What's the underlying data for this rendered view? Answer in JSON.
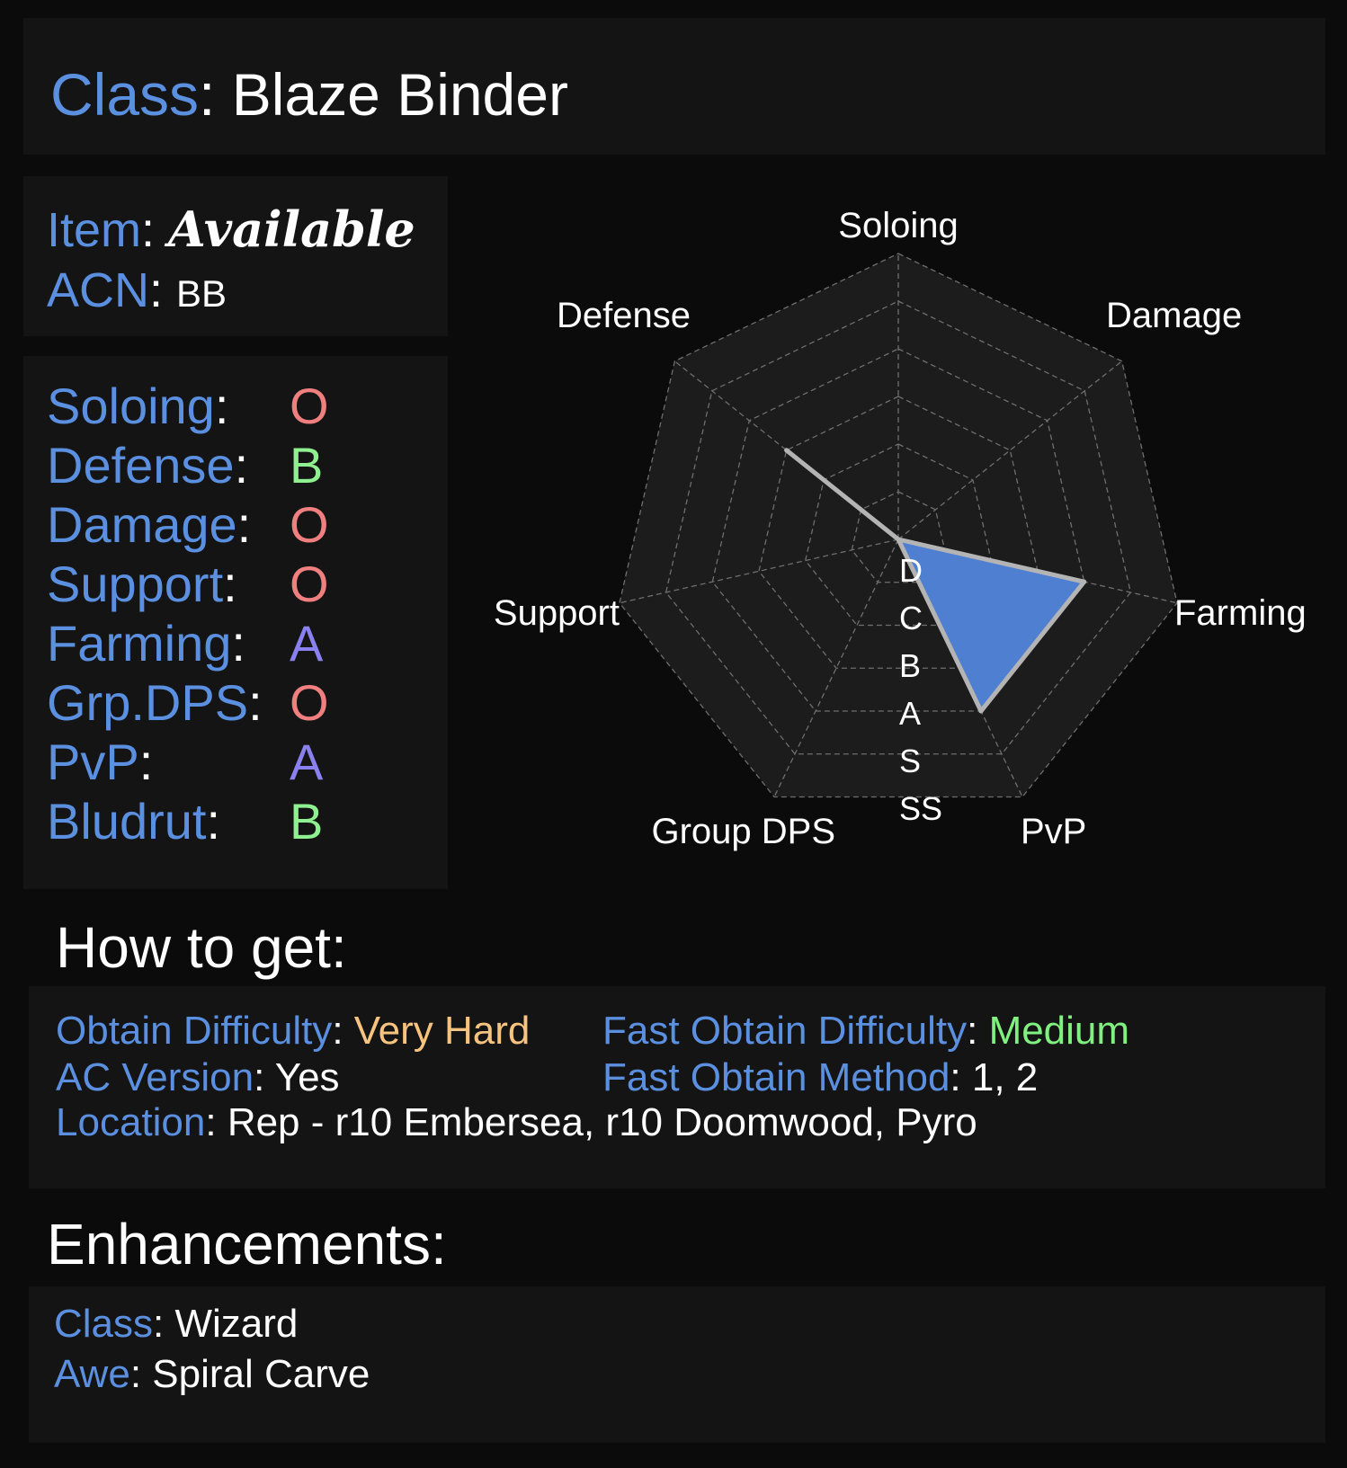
{
  "header": {
    "class_label": "Class",
    "class_value": "Blaze Binder"
  },
  "info": {
    "item_label": "Item",
    "item_value": "Available",
    "acn_label": "ACN",
    "acn_value": "BB"
  },
  "grades": [
    {
      "label": "Soloing",
      "value": "O",
      "color": "#f08080"
    },
    {
      "label": "Defense",
      "value": "B",
      "color": "#8ef08e"
    },
    {
      "label": "Damage",
      "value": "O",
      "color": "#f08080"
    },
    {
      "label": "Support",
      "value": "O",
      "color": "#f08080"
    },
    {
      "label": "Farming",
      "value": "A",
      "color": "#8a80f0"
    },
    {
      "label": "Grp.DPS",
      "value": "O",
      "color": "#f08080"
    },
    {
      "label": "PvP",
      "value": "A",
      "color": "#8a80f0"
    },
    {
      "label": "Bludrut",
      "value": "B",
      "color": "#8ef08e"
    }
  ],
  "chart_data": {
    "type": "radar",
    "axes": [
      "Soloing",
      "Damage",
      "Farming",
      "PvP",
      "Group DPS",
      "Support",
      "Defense"
    ],
    "scale_labels": [
      "D",
      "C",
      "B",
      "A",
      "S",
      "SS"
    ],
    "values": [
      0,
      0,
      4,
      4,
      0,
      0,
      3
    ],
    "fill_color": "#4f7fd1",
    "line_color": "#b4b4b4",
    "grid": true
  },
  "how_to_get": {
    "heading": "How to get:",
    "obtain_difficulty_label": "Obtain Difficulty",
    "obtain_difficulty_value": "Very Hard",
    "obtain_difficulty_color": "#f7c480",
    "fast_obtain_difficulty_label": "Fast Obtain Difficulty",
    "fast_obtain_difficulty_value": "Medium",
    "fast_obtain_difficulty_color": "#80f080",
    "ac_version_label": "AC Version",
    "ac_version_value": "Yes",
    "fast_obtain_method_label": "Fast Obtain Method",
    "fast_obtain_method_value": "1, 2",
    "location_label": "Location",
    "location_value": "Rep - r10 Embersea, r10 Doomwood, Pyro"
  },
  "enhancements": {
    "heading": "Enhancements:",
    "class_label": "Class",
    "class_value": "Wizard",
    "awe_label": "Awe",
    "awe_value": "Spiral Carve"
  }
}
